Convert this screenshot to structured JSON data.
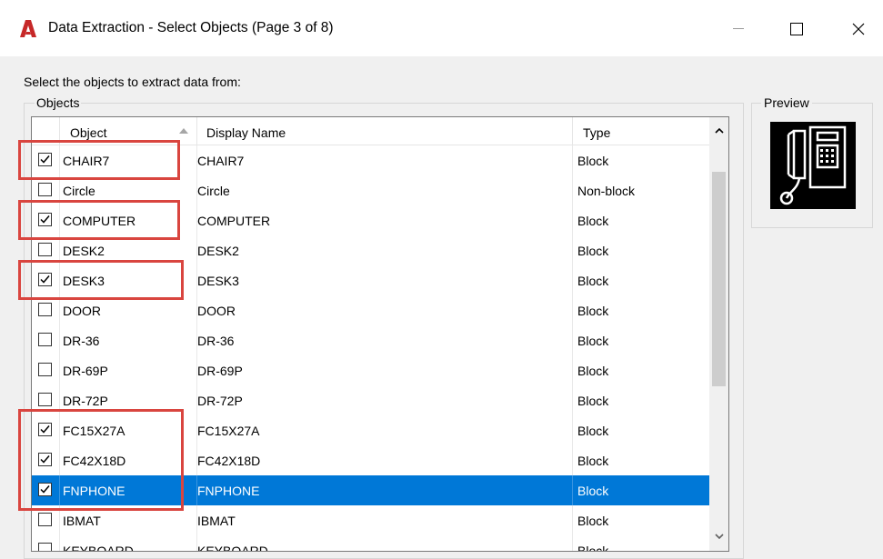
{
  "window": {
    "title": "Data Extraction - Select Objects (Page 3 of 8)",
    "controls": {
      "minimize": "—",
      "maximize": "☐",
      "close": "✕"
    }
  },
  "instruction": "Select the objects to extract data from:",
  "objects_group": {
    "label": "Objects",
    "columns": {
      "object": "Object",
      "display_name": "Display Name",
      "type": "Type"
    },
    "sort_column": "Object",
    "rows": [
      {
        "object": "CHAIR7",
        "display": "CHAIR7",
        "type": "Block",
        "checked": true,
        "selected": false
      },
      {
        "object": "Circle",
        "display": "Circle",
        "type": "Non-block",
        "checked": false,
        "selected": false
      },
      {
        "object": "COMPUTER",
        "display": "COMPUTER",
        "type": "Block",
        "checked": true,
        "selected": false
      },
      {
        "object": "DESK2",
        "display": "DESK2",
        "type": "Block",
        "checked": false,
        "selected": false
      },
      {
        "object": "DESK3",
        "display": "DESK3",
        "type": "Block",
        "checked": true,
        "selected": false
      },
      {
        "object": "DOOR",
        "display": "DOOR",
        "type": "Block",
        "checked": false,
        "selected": false
      },
      {
        "object": "DR-36",
        "display": "DR-36",
        "type": "Block",
        "checked": false,
        "selected": false
      },
      {
        "object": "DR-69P",
        "display": "DR-69P",
        "type": "Block",
        "checked": false,
        "selected": false
      },
      {
        "object": "DR-72P",
        "display": "DR-72P",
        "type": "Block",
        "checked": false,
        "selected": false
      },
      {
        "object": "FC15X27A",
        "display": "FC15X27A",
        "type": "Block",
        "checked": true,
        "selected": false
      },
      {
        "object": "FC42X18D",
        "display": "FC42X18D",
        "type": "Block",
        "checked": true,
        "selected": false
      },
      {
        "object": "FNPHONE",
        "display": "FNPHONE",
        "type": "Block",
        "checked": true,
        "selected": true
      },
      {
        "object": "IBMAT",
        "display": "IBMAT",
        "type": "Block",
        "checked": false,
        "selected": false
      },
      {
        "object": "KEYBOARD",
        "display": "KEYBOARD",
        "type": "Block",
        "checked": false,
        "selected": false
      }
    ]
  },
  "preview": {
    "label": "Preview",
    "icon": "phone-block-preview-icon"
  },
  "colors": {
    "selection": "#0078d7",
    "highlight": "#d9453f",
    "app_logo": "#c62828"
  }
}
